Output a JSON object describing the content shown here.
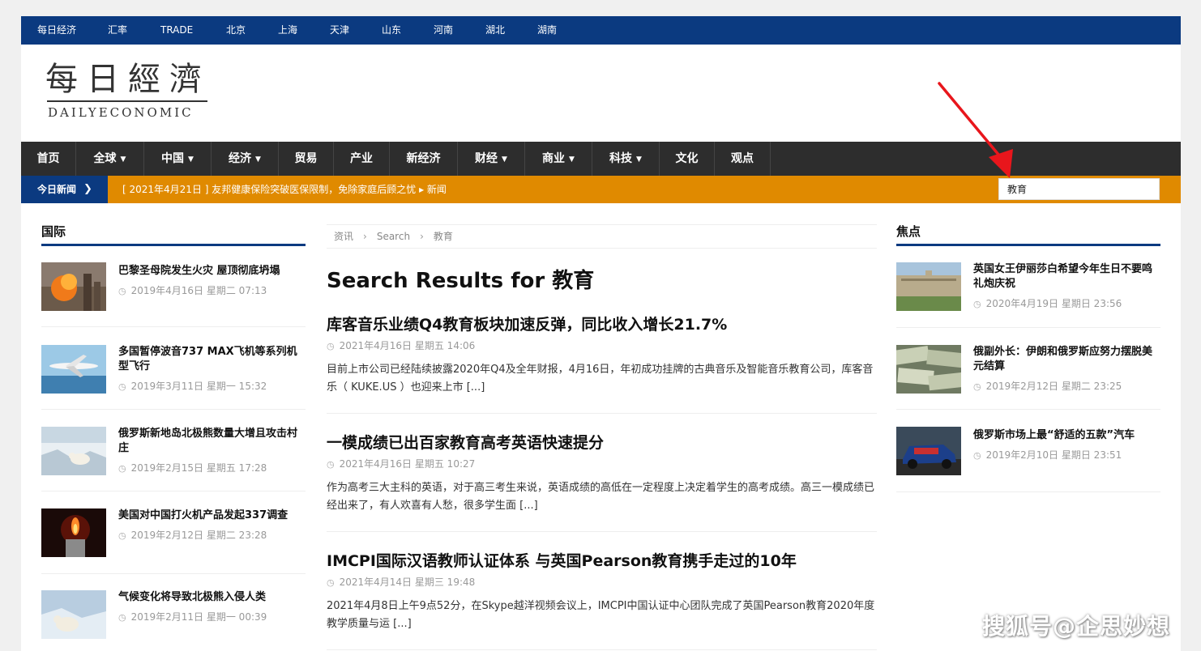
{
  "topbar": {
    "links": [
      "每日经济",
      "汇率",
      "TRADE",
      "北京",
      "上海",
      "天津",
      "山东",
      "河南",
      "湖北",
      "湖南"
    ]
  },
  "logo": {
    "chinese": "每日經濟",
    "english": "DAILYECONOMIC"
  },
  "nav": {
    "items": [
      {
        "label": "首页",
        "dropdown": false
      },
      {
        "label": "全球",
        "dropdown": true
      },
      {
        "label": "中国",
        "dropdown": true
      },
      {
        "label": "经济",
        "dropdown": true
      },
      {
        "label": "贸易",
        "dropdown": false
      },
      {
        "label": "产业",
        "dropdown": false
      },
      {
        "label": "新经济",
        "dropdown": false
      },
      {
        "label": "财经",
        "dropdown": true
      },
      {
        "label": "商业",
        "dropdown": true
      },
      {
        "label": "科技",
        "dropdown": true
      },
      {
        "label": "文化",
        "dropdown": false
      },
      {
        "label": "观点",
        "dropdown": false
      }
    ]
  },
  "ticker": {
    "label": "今日新闻",
    "text": "[ 2021年4月21日 ]  友邦健康保险突破医保限制，免除家庭后顾之忧  ▸  新闻"
  },
  "search": {
    "value": "教育"
  },
  "left_sidebar": {
    "title": "国际",
    "items": [
      {
        "title": "巴黎圣母院发生火灾 屋顶彻底坍塌",
        "date": "2019年4月16日 星期二 07:13"
      },
      {
        "title": "多国暂停波音737 MAX飞机等系列机型飞行",
        "date": "2019年3月11日 星期一 15:32"
      },
      {
        "title": "俄罗斯新地岛北极熊数量大增且攻击村庄",
        "date": "2019年2月15日 星期五 17:28"
      },
      {
        "title": "美国对中国打火机产品发起337调查",
        "date": "2019年2月12日 星期二 23:28"
      },
      {
        "title": "气候变化将导致北极熊入侵人类",
        "date": "2019年2月11日 星期一 00:39"
      }
    ]
  },
  "breadcrumb": {
    "items": [
      "资讯",
      "Search",
      "教育"
    ],
    "separator": "›"
  },
  "results": {
    "heading": "Search Results for 教育",
    "items": [
      {
        "title": "库客音乐业绩Q4教育板块加速反弹，同比收入增长21.7%",
        "date": "2021年4月16日 星期五 14:06",
        "excerpt": "目前上市公司已经陆续披露2020年Q4及全年财报，4月16日，年初成功挂牌的古典音乐及智能音乐教育公司，库客音乐（ KUKE.US ）也迎来上市 [...]"
      },
      {
        "title": "一模成绩已出百家教育高考英语快速提分",
        "date": "2021年4月16日 星期五 10:27",
        "excerpt": "作为高考三大主科的英语，对于高三考生来说，英语成绩的高低在一定程度上决定着学生的高考成绩。高三一模成绩已经出来了，有人欢喜有人愁，很多学生面 [...]"
      },
      {
        "title": "IMCPI国际汉语教师认证体系 与英国Pearson教育携手走过的10年",
        "date": "2021年4月14日 星期三 19:48",
        "excerpt": "2021年4月8日上午9点52分，在Skype越洋视频会议上，IMCPI中国认证中心团队完成了英国Pearson教育2020年度教学质量与运 [...]"
      }
    ]
  },
  "right_sidebar": {
    "title": "焦点",
    "items": [
      {
        "title": "英国女王伊丽莎白希望今年生日不要鸣礼炮庆祝",
        "date": "2020年4月19日 星期日 23:56"
      },
      {
        "title": "俄副外长：伊朗和俄罗斯应努力摆脱美元结算",
        "date": "2019年2月12日 星期二 23:25"
      },
      {
        "title": "俄罗斯市场上最“舒适的五款”汽车",
        "date": "2019年2月10日 星期日 23:51"
      }
    ]
  },
  "watermark": {
    "text": "搜狐号@企思妙想"
  },
  "colors": {
    "brand_blue": "#0b3a80",
    "ticker_orange": "#e08a00",
    "nav_dark": "#2d2d2d",
    "arrow_red": "#e8161c"
  },
  "icons": [
    "clock-icon",
    "chevron-down-icon",
    "chevron-right-icon",
    "red-arrow-icon"
  ]
}
